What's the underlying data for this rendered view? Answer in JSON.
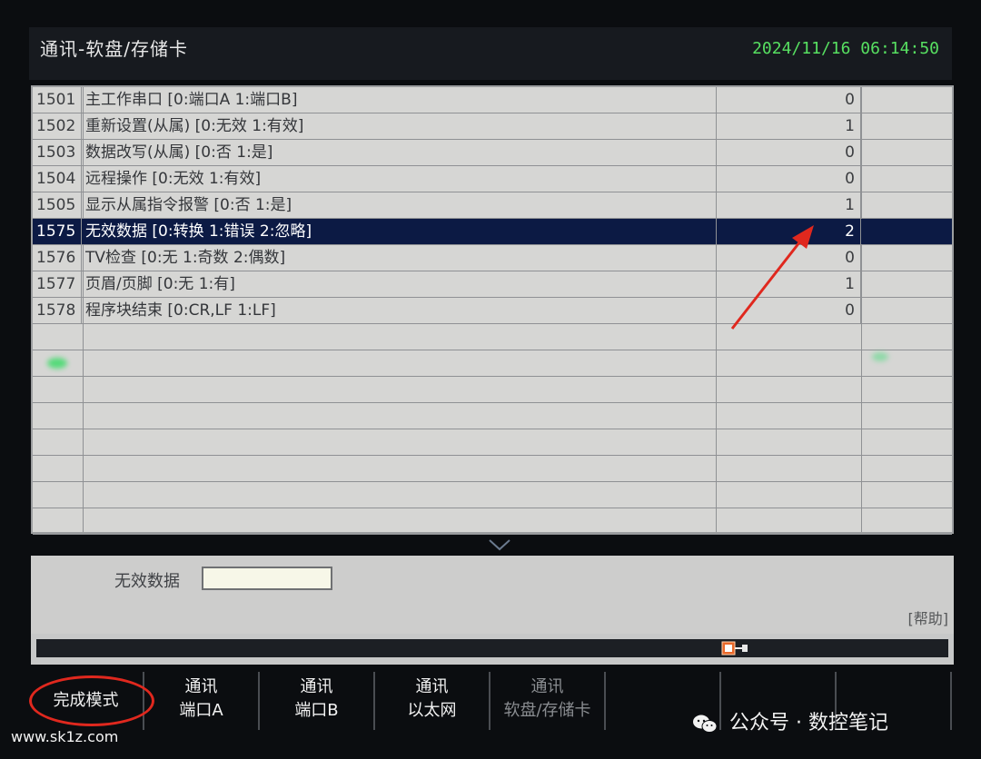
{
  "header": {
    "title": "通讯-软盘/存储卡",
    "datetime": "2024/11/16 06:14:50"
  },
  "params": [
    {
      "no": "1501",
      "desc": "主工作串口 [0:端口A  1:端口B]",
      "value": "0"
    },
    {
      "no": "1502",
      "desc": "重新设置(从属) [0:无效  1:有效]",
      "value": "1"
    },
    {
      "no": "1503",
      "desc": "数据改写(从属) [0:否  1:是]",
      "value": "0"
    },
    {
      "no": "1504",
      "desc": "远程操作 [0:无效  1:有效]",
      "value": "0"
    },
    {
      "no": "1505",
      "desc": "显示从属指令报警 [0:否  1:是]",
      "value": "1"
    },
    {
      "no": "1575",
      "desc": "无效数据 [0:转换  1:错误  2:忽略]",
      "value": "2",
      "selected": true
    },
    {
      "no": "1576",
      "desc": "TV检查 [0:无  1:奇数  2:偶数]",
      "value": "0"
    },
    {
      "no": "1577",
      "desc": "页眉/页脚 [0:无  1:有]",
      "value": "1"
    },
    {
      "no": "1578",
      "desc": "程序块结束 [0:CR,LF  1:LF]",
      "value": "0"
    }
  ],
  "input": {
    "label": "无效数据",
    "value": ""
  },
  "help_label": "[帮助]",
  "softkeys": [
    {
      "line1": "完成模式",
      "line2": "",
      "dim": false
    },
    {
      "line1": "通讯",
      "line2": "端口A",
      "dim": false
    },
    {
      "line1": "通讯",
      "line2": "端口B",
      "dim": false
    },
    {
      "line1": "通讯",
      "line2": "以太网",
      "dim": false
    },
    {
      "line1": "通讯",
      "line2": "软盘/存储卡",
      "dim": true
    },
    {
      "line1": "",
      "line2": "",
      "dim": false
    },
    {
      "line1": "",
      "line2": "",
      "dim": false
    },
    {
      "line1": "",
      "line2": "",
      "dim": false
    }
  ],
  "watermark": {
    "left": "www.sk1z.com",
    "right": "公众号 · 数控笔记"
  },
  "colors": {
    "selected_row": "#0c1a44",
    "clock": "#57e061",
    "annotation": "#e0281e"
  }
}
